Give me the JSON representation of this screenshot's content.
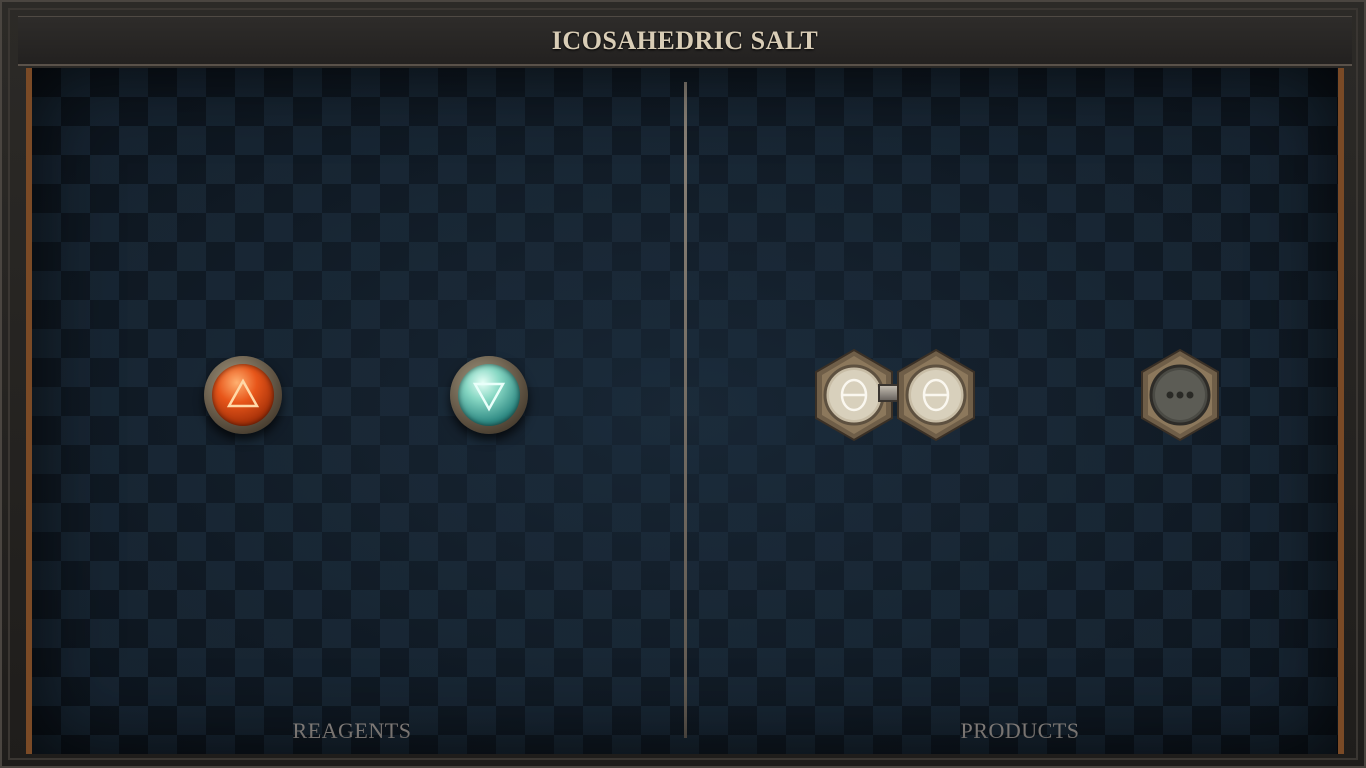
{
  "title": "ICOSAHEDRIC SALT",
  "sections": {
    "reagents_label": "REAGENTS",
    "products_label": "PRODUCTS"
  },
  "reagents": [
    {
      "element": "fire",
      "symbol": "fire-triangle-icon",
      "color": "#e8561a"
    },
    {
      "element": "water",
      "symbol": "water-triangle-icon",
      "color": "#2f8a84"
    }
  ],
  "products": [
    {
      "element": "salt",
      "symbol": "salt-theta-icon",
      "bonded_to": 1
    },
    {
      "element": "salt",
      "symbol": "salt-theta-icon",
      "bonded_to": 0
    },
    {
      "element": "mors-or-unknown",
      "symbol": "three-dots-icon"
    }
  ],
  "colors": {
    "title_text": "#d9cdb6",
    "board_bg": "#0f1822",
    "label_text": "#9a9490",
    "frame_accent": "#7a4a26"
  }
}
